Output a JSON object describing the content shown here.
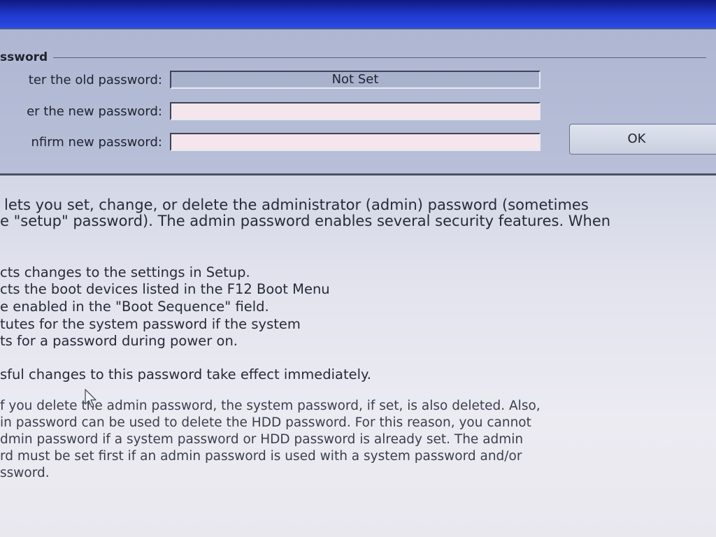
{
  "password_group": {
    "legend": "ssword",
    "old_label": "ter the old password:",
    "old_value": "Not Set",
    "new_label": "er the new password:",
    "new_value": "",
    "confirm_label": "nfirm new password:",
    "confirm_value": "",
    "ok_label": "OK"
  },
  "help": {
    "intro": [
      "lets you set, change, or delete the administrator (admin) password (sometimes",
      "e \"setup\" password).  The admin password enables several security features. When"
    ],
    "features": [
      "cts changes to the settings in Setup.",
      "cts the boot devices listed in the F12 Boot Menu",
      "e enabled in the \"Boot Sequence\" field.",
      "tutes for the system password if the system",
      "ts for a password during power on."
    ],
    "note": "sful changes to this password take effect immediately.",
    "warning": [
      "f you delete the admin password, the system password, if set, is also deleted. Also,",
      "in password can be used to delete the HDD password.  For this reason, you cannot",
      "dmin password if a system password or HDD password is already set. The admin",
      "rd must be set first if an admin password is used with a system password and/or",
      "ssword."
    ]
  },
  "icons": {
    "cursor": "mouse-pointer-icon"
  }
}
